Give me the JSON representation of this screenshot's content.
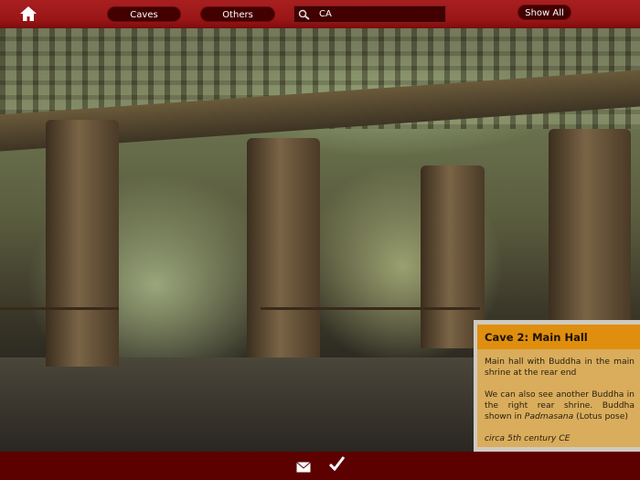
{
  "topbar": {
    "home_icon": "home-icon",
    "caves_label": "Caves",
    "others_label": "Others",
    "search_value": "CA",
    "show_all_label": "Show All"
  },
  "info_panel": {
    "title": "Cave 2: Main Hall",
    "para1": "Main hall with Buddha in the main shrine at the rear end",
    "para2_pre": "We can also see another Buddha in the right rear shrine. Buddha shown in ",
    "para2_italic": "Padmasana",
    "para2_post": " (Lotus pose)",
    "date": "circa 5th century CE"
  },
  "bottombar": {
    "mail_icon": "mail-icon",
    "check_icon": "check-icon"
  },
  "colors": {
    "topbar": "#a01a1b",
    "bottombar": "#5c0000",
    "panel_header": "#e08e0e",
    "panel_body": "#d9ad5c"
  }
}
